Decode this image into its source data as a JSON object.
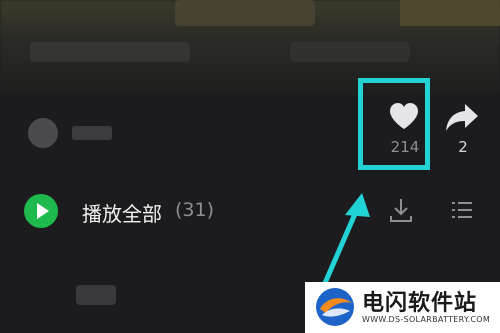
{
  "like": {
    "count": "214"
  },
  "share": {
    "count": "2"
  },
  "playlist": {
    "play_all_label": "播放全部",
    "track_count": "(31)"
  },
  "watermark": {
    "title": "电闪软件站",
    "url": "WWW.DS-SOLARBATTERY.COM"
  },
  "colors": {
    "highlight": "#22d3d6",
    "play_green": "#1fba4e",
    "background": "#1c1c1e"
  },
  "icons": [
    "heart-icon",
    "share-icon",
    "play-icon",
    "download-icon",
    "list-icon",
    "arrow-icon"
  ]
}
